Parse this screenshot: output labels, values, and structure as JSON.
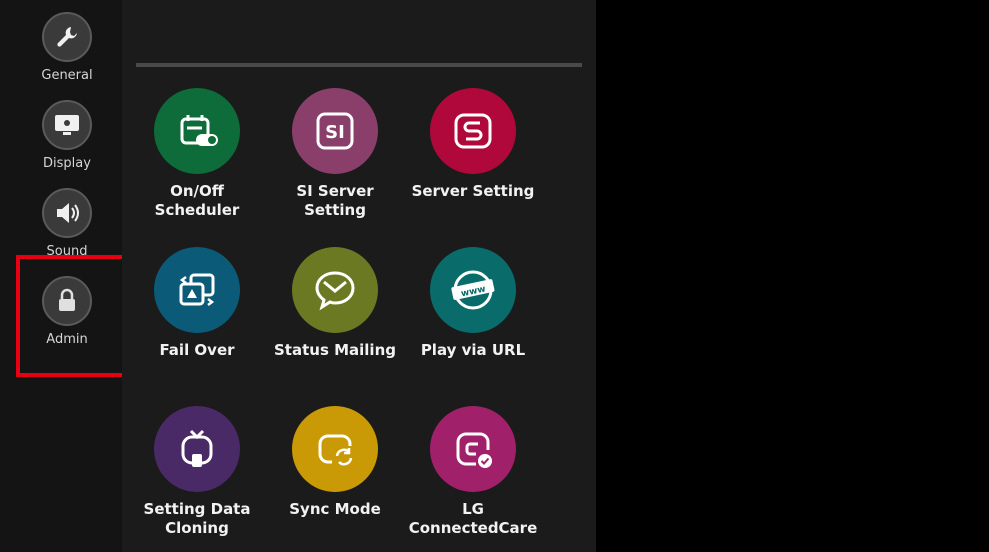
{
  "sidebar": {
    "items": [
      {
        "label": "General",
        "icon": "wrench-icon"
      },
      {
        "label": "Display",
        "icon": "monitor-icon"
      },
      {
        "label": "Sound",
        "icon": "speaker-icon"
      },
      {
        "label": "Admin",
        "icon": "lock-icon"
      }
    ]
  },
  "tiles": [
    {
      "label": "On/Off Scheduler",
      "icon": "calendar-toggle-icon",
      "color": "#0e6b3a"
    },
    {
      "label": "SI Server Setting",
      "icon": "si-server-icon",
      "color": "#8a3f6b"
    },
    {
      "label": "Server Setting",
      "icon": "server-setting-icon",
      "color": "#b0083a"
    },
    {
      "label": "Fail Over",
      "icon": "fail-over-icon",
      "color": "#0a5a78"
    },
    {
      "label": "Status Mailing",
      "icon": "mail-icon",
      "color": "#6b7a22"
    },
    {
      "label": "Play via URL",
      "icon": "www-icon",
      "color": "#0a6b6b"
    },
    {
      "label": "Setting Data Cloning",
      "icon": "cloning-icon",
      "color": "#4a2a66"
    },
    {
      "label": "Sync Mode",
      "icon": "sync-icon",
      "color": "#c99a06"
    },
    {
      "label": "LG ConnectedCare",
      "icon": "connected-care-icon",
      "color": "#a0206a"
    }
  ],
  "colors": {
    "highlight": "#e60012",
    "sidebar_bg": "#141414",
    "main_bg": "#1b1b1b"
  }
}
